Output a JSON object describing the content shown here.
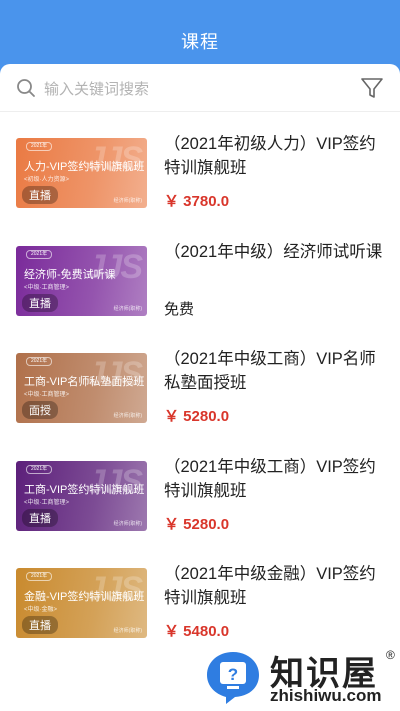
{
  "header": {
    "title": "课程"
  },
  "search": {
    "placeholder": "输入关键词搜索",
    "search_icon": "search-icon",
    "filter_icon": "filter-icon"
  },
  "courses": [
    {
      "thumb_year": "2021年",
      "thumb_title": "人力-VIP签约特训旗舰班",
      "thumb_sub": "<初级·人力资源>",
      "thumb_tag": "直播",
      "thumb_brand": "经济师(职称)",
      "thumb_color": "#ea7a43",
      "title": "（2021年初级人力）VIP签约特训旗舰班",
      "price": "￥ 3780.0"
    },
    {
      "thumb_year": "2021年",
      "thumb_title": "经济师-免费试听课",
      "thumb_sub": "<中级·工商管理>",
      "thumb_tag": "直播",
      "thumb_brand": "经济师(职称)",
      "thumb_color": "#7a2a9a",
      "title": "（2021年中级）经济师试听课",
      "price": "免费"
    },
    {
      "thumb_year": "2021年",
      "thumb_title": "工商-VIP名师私塾面授班",
      "thumb_sub": "<中级·工商管理>",
      "thumb_tag": "面授",
      "thumb_brand": "经济师(职称)",
      "thumb_color": "#b0704a",
      "title": "（2021年中级工商）VIP名师私塾面授班",
      "price": "￥ 5280.0"
    },
    {
      "thumb_year": "2021年",
      "thumb_title": "工商-VIP签约特训旗舰班",
      "thumb_sub": "<中级·工商管理>",
      "thumb_tag": "直播",
      "thumb_brand": "经济师(职称)",
      "thumb_color": "#5c1f7a",
      "title": "（2021年中级工商）VIP签约特训旗舰班",
      "price": "￥ 5280.0"
    },
    {
      "thumb_year": "2021年",
      "thumb_title": "金融-VIP签约特训旗舰班",
      "thumb_sub": "<中级·金融>",
      "thumb_tag": "直播",
      "thumb_brand": "经济师(职称)",
      "thumb_color": "#c98a2e",
      "title": "（2021年中级金融）VIP签约特训旗舰班",
      "price": "￥ 5480.0"
    }
  ],
  "watermark": {
    "name": "知识屋",
    "url": "zhishiwu.com",
    "reg": "®"
  }
}
